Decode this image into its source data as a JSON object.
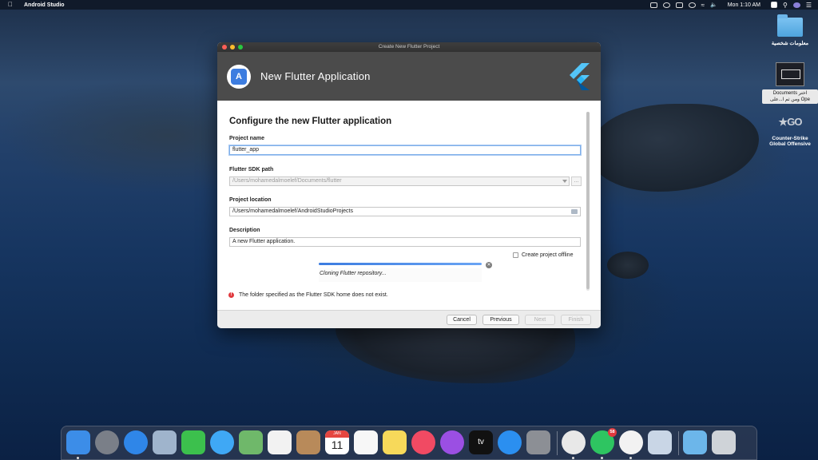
{
  "menubar": {
    "app_name": "Android Studio",
    "clock": "Mon 1:10 AM"
  },
  "desktop": {
    "items": [
      {
        "label": "معلومات شخصية",
        "icon": "folder-icon"
      },
      {
        "label_lines": [
          "Documents",
          "ومن ثم ا...على",
          "Ope"
        ],
        "partial_right": "اختر",
        "icon": "document-thumbnail"
      },
      {
        "label_lines": [
          "Counter-Strike",
          "Global Offensive"
        ],
        "icon": "counter-strike-icon",
        "logo_text": "GO"
      }
    ]
  },
  "dialog": {
    "window_title": "Create New Flutter Project",
    "header_title": "New Flutter Application",
    "section_title": "Configure the new Flutter application",
    "project_name": {
      "label": "Project name",
      "value": "flutter_app"
    },
    "sdk_path": {
      "label": "Flutter SDK path",
      "value": "/Users/mohamedalmoelef/Documents/flutter",
      "browse_label": "..."
    },
    "project_location": {
      "label": "Project location",
      "value": "/Users/mohamedalmoelef/AndroidStudioProjects"
    },
    "description": {
      "label": "Description",
      "value": "A new Flutter application."
    },
    "offline_checkbox": {
      "label": "Create project offline",
      "checked": false
    },
    "progress": {
      "text": "Cloning Flutter repository...",
      "fraction": 1.0
    },
    "error_message": "The folder specified as the Flutter SDK home does not exist.",
    "buttons": {
      "cancel": "Cancel",
      "previous": "Previous",
      "next": "Next",
      "finish": "Finish"
    }
  },
  "dock": {
    "apps": [
      {
        "name": "finder-icon",
        "color": "#3c8de8"
      },
      {
        "name": "launchpad-icon",
        "color": "#7a7f88"
      },
      {
        "name": "safari-icon",
        "color": "#2f86e8"
      },
      {
        "name": "mail-icon",
        "color": "#9fb4cc"
      },
      {
        "name": "facetime-icon",
        "color": "#3cc04d"
      },
      {
        "name": "messages-icon",
        "color": "#3fa8f5"
      },
      {
        "name": "maps-icon",
        "color": "#6fb86a"
      },
      {
        "name": "photos-icon",
        "color": "#f2f2f2"
      },
      {
        "name": "contacts-icon",
        "color": "#b88a5a"
      },
      {
        "name": "calendar-icon",
        "color": "#ffffff",
        "month": "JAN",
        "day": "11"
      },
      {
        "name": "reminders-icon",
        "color": "#f7f7f7"
      },
      {
        "name": "notes-icon",
        "color": "#f7d95a"
      },
      {
        "name": "music-icon",
        "color": "#f14a63"
      },
      {
        "name": "podcasts-icon",
        "color": "#9b4fe3"
      },
      {
        "name": "tv-icon",
        "color": "#111111",
        "label": "tv"
      },
      {
        "name": "app-store-icon",
        "color": "#2b8ff0"
      },
      {
        "name": "system-preferences-icon",
        "color": "#8c8f95"
      },
      {
        "name": "chrome-icon",
        "color": "#e8e8e8"
      },
      {
        "name": "whatsapp-icon",
        "color": "#2ec561",
        "badge": "58"
      },
      {
        "name": "android-studio-icon",
        "color": "#f2f2f2"
      },
      {
        "name": "preview-icon",
        "color": "#c9d6e6"
      },
      {
        "name": "downloads-folder-icon",
        "color": "#6cb6ea"
      },
      {
        "name": "trash-icon",
        "color": "#cfd3d8"
      }
    ]
  }
}
